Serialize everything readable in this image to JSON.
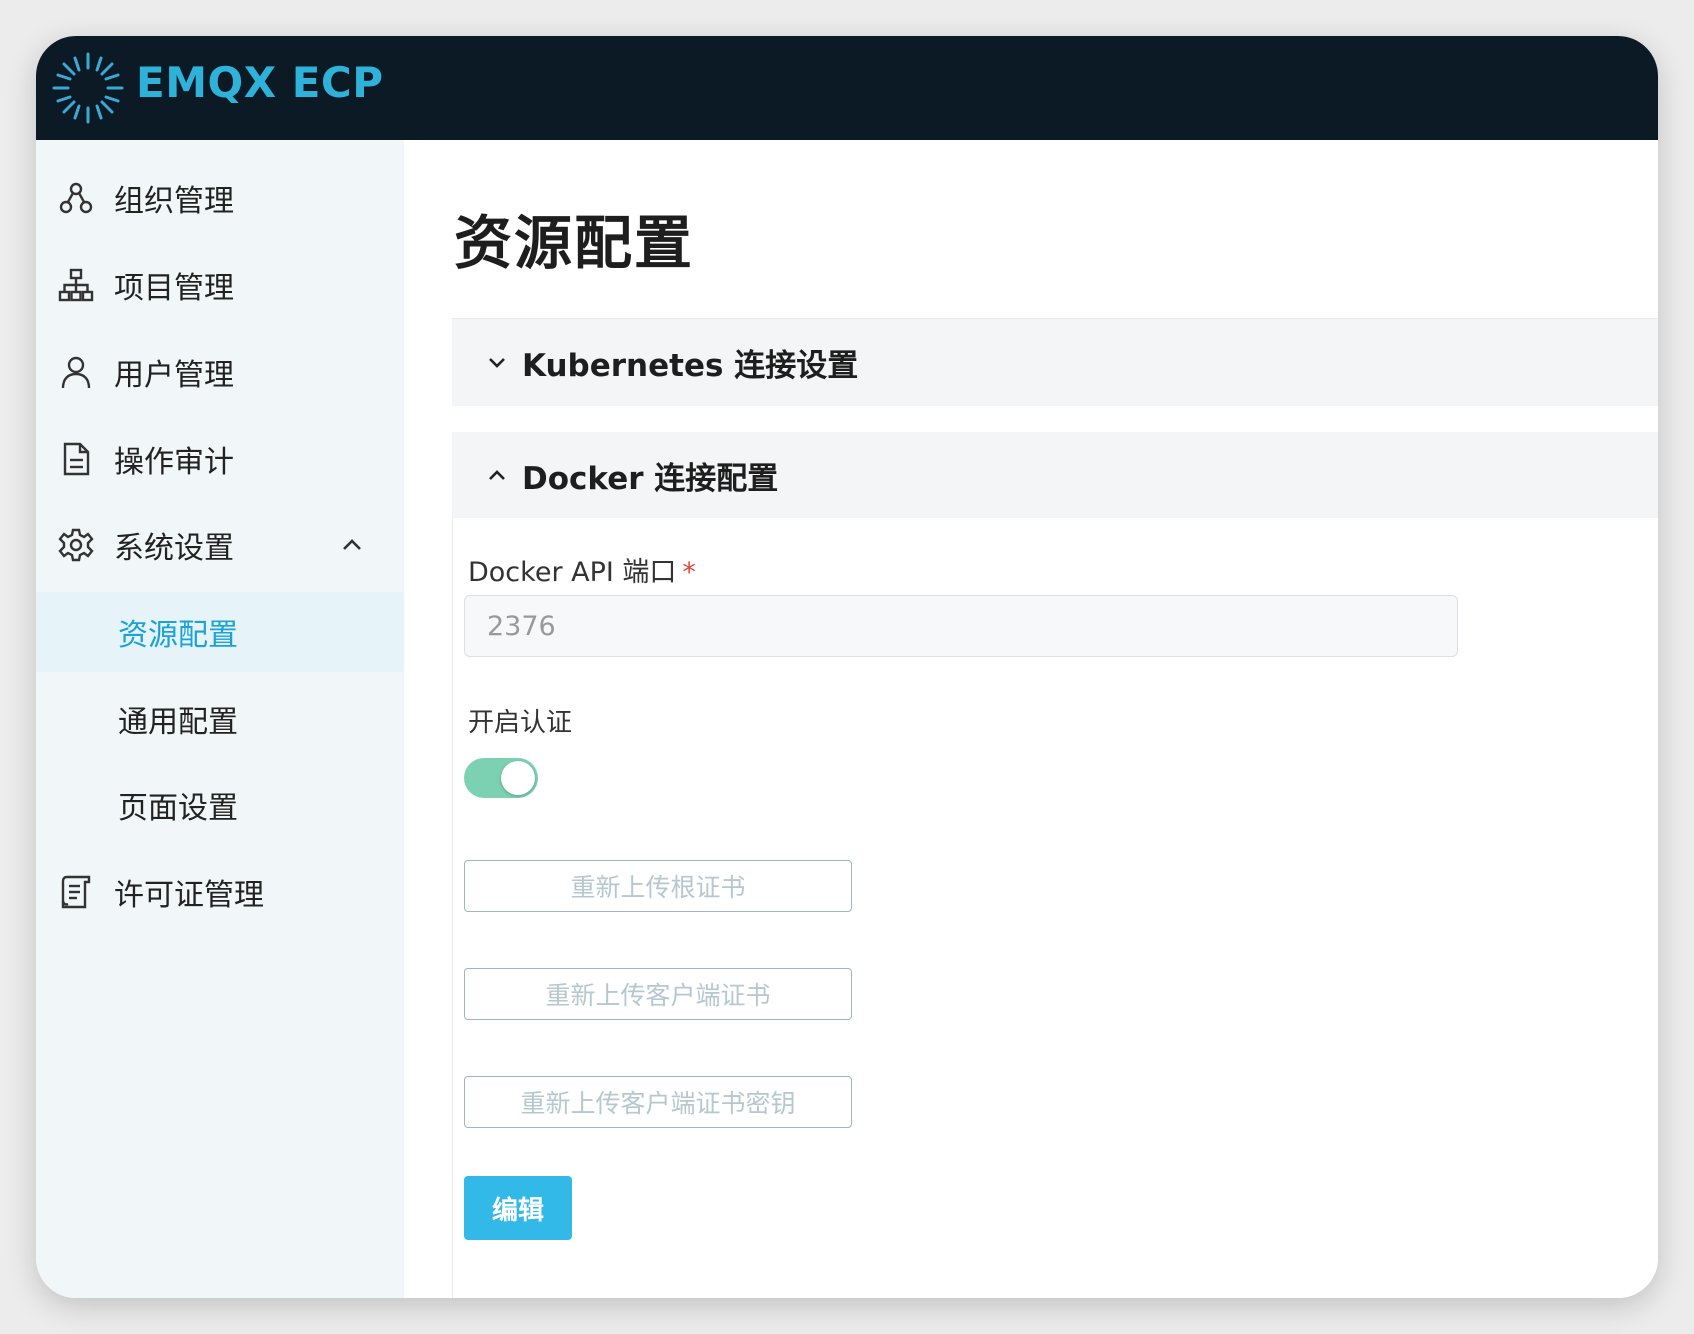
{
  "app": {
    "brand": "EMQX ECP"
  },
  "sidebar": {
    "items": [
      {
        "label": "组织管理",
        "icon": "org-icon"
      },
      {
        "label": "项目管理",
        "icon": "hierarchy-icon"
      },
      {
        "label": "用户管理",
        "icon": "user-icon"
      },
      {
        "label": "操作审计",
        "icon": "document-icon"
      },
      {
        "label": "系统设置",
        "icon": "gear-icon",
        "expanded": true
      },
      {
        "label": "资源配置",
        "active": true
      },
      {
        "label": "通用配置"
      },
      {
        "label": "页面设置"
      },
      {
        "label": "许可证管理",
        "icon": "license-icon"
      }
    ]
  },
  "main": {
    "title": "资源配置",
    "panels": [
      {
        "title": "Kubernetes 连接设置",
        "expanded": false
      },
      {
        "title": "Docker 连接配置",
        "expanded": true
      }
    ],
    "docker": {
      "port_label": "Docker API 端口",
      "required_mark": "*",
      "port_value": "2376",
      "auth_label": "开启认证",
      "auth_enabled": true,
      "buttons": {
        "upload_root_cert": "重新上传根证书",
        "upload_client_cert": "重新上传客户端证书",
        "upload_client_key": "重新上传客户端证书密钥",
        "edit": "编辑"
      }
    }
  },
  "colors": {
    "topbar": "#0b1a24",
    "brand": "#2fb2d9",
    "active": "#1aa3d6",
    "toggle_on": "#7dd1b3",
    "primary_button": "#33b9e8"
  }
}
